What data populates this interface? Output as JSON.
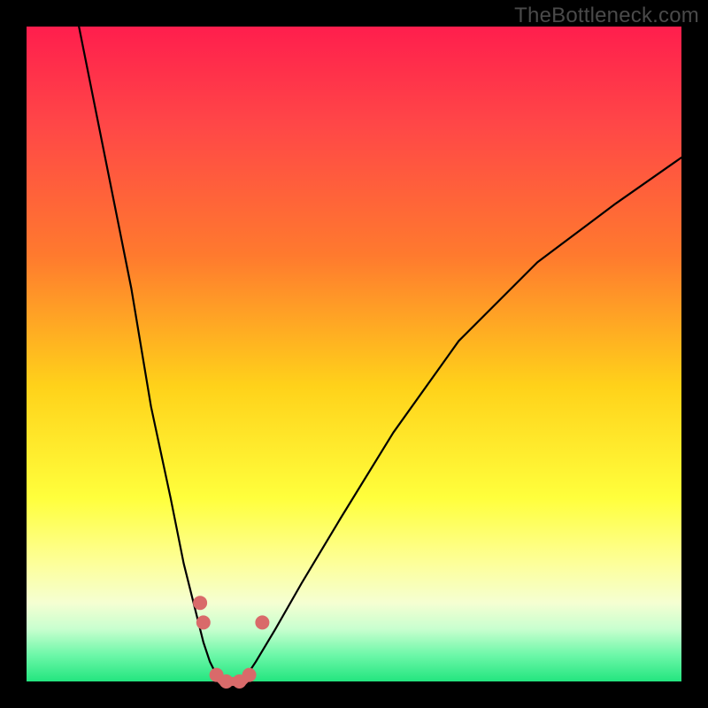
{
  "watermark": "TheBottleneck.com",
  "chart_data": {
    "type": "line",
    "title": "",
    "xlabel": "",
    "ylabel": "",
    "xlim": [
      0,
      100
    ],
    "ylim": [
      0,
      100
    ],
    "grid": false,
    "legend": false,
    "background_gradient": {
      "stops": [
        {
          "pos": 0.0,
          "color": "#ff1e4d"
        },
        {
          "pos": 0.15,
          "color": "#ff4747"
        },
        {
          "pos": 0.35,
          "color": "#ff7a2e"
        },
        {
          "pos": 0.55,
          "color": "#ffd21a"
        },
        {
          "pos": 0.72,
          "color": "#ffff3c"
        },
        {
          "pos": 0.82,
          "color": "#fdff9a"
        },
        {
          "pos": 0.88,
          "color": "#f5ffd2"
        },
        {
          "pos": 0.92,
          "color": "#c8ffcf"
        },
        {
          "pos": 0.96,
          "color": "#6cf7a8"
        },
        {
          "pos": 1.0,
          "color": "#23e57f"
        }
      ]
    },
    "series": [
      {
        "name": "curve-left",
        "x": [
          8,
          12,
          16,
          19,
          22,
          24,
          26,
          27,
          28,
          29,
          30
        ],
        "y": [
          100,
          80,
          60,
          42,
          28,
          18,
          10,
          6,
          3,
          1,
          0
        ],
        "stroke": "#000000",
        "width": 2.2
      },
      {
        "name": "curve-right",
        "x": [
          33,
          35,
          38,
          42,
          48,
          56,
          66,
          78,
          90,
          100
        ],
        "y": [
          0,
          3,
          8,
          15,
          25,
          38,
          52,
          64,
          73,
          80
        ],
        "stroke": "#000000",
        "width": 2.2
      },
      {
        "name": "bottom-stroke",
        "x": [
          29,
          30,
          31,
          32,
          33,
          34
        ],
        "y": [
          1,
          0,
          0,
          0,
          0,
          1
        ],
        "stroke": "#d96a6a",
        "width": 10
      }
    ],
    "markers": [
      {
        "x": 26.5,
        "y": 12,
        "r": 8,
        "color": "#d96a6a"
      },
      {
        "x": 27.0,
        "y": 9,
        "r": 8,
        "color": "#d96a6a"
      },
      {
        "x": 29.0,
        "y": 1,
        "r": 8,
        "color": "#d96a6a"
      },
      {
        "x": 30.5,
        "y": 0,
        "r": 8,
        "color": "#d96a6a"
      },
      {
        "x": 32.5,
        "y": 0,
        "r": 8,
        "color": "#d96a6a"
      },
      {
        "x": 34.0,
        "y": 1,
        "r": 8,
        "color": "#d96a6a"
      },
      {
        "x": 36.0,
        "y": 9,
        "r": 8,
        "color": "#d96a6a"
      }
    ]
  }
}
